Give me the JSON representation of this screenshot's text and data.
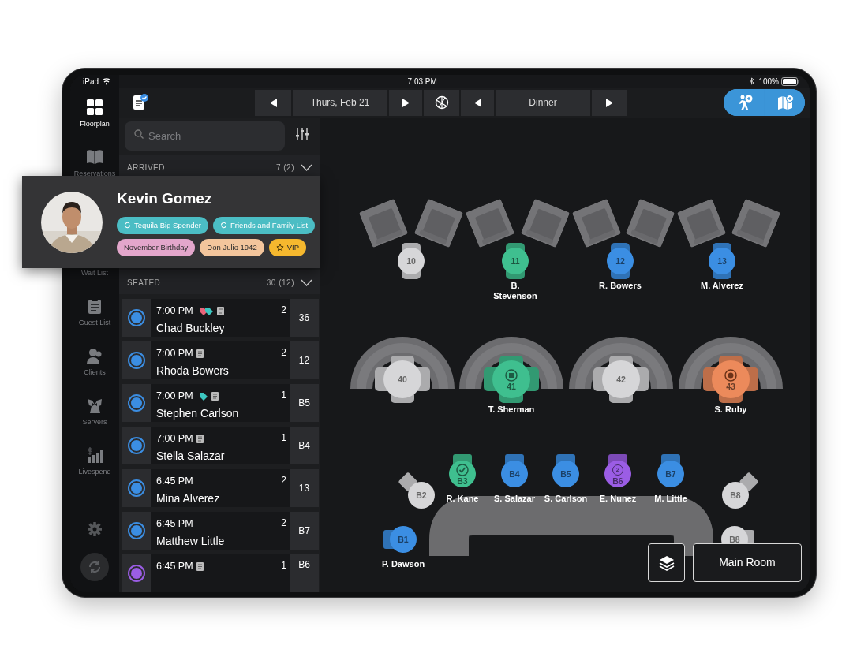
{
  "status_bar": {
    "device": "iPad",
    "time": "7:03 PM",
    "battery": "100%"
  },
  "sidebar": {
    "items": [
      {
        "label": "Floorplan",
        "selected": true
      },
      {
        "label": "Reservations",
        "selected": false
      },
      {
        "label": "Wait List",
        "selected": false
      },
      {
        "label": "Guest List",
        "selected": false
      },
      {
        "label": "Clients",
        "selected": false
      },
      {
        "label": "Servers",
        "selected": false
      },
      {
        "label": "Livespend",
        "selected": false
      }
    ]
  },
  "toolbar": {
    "date": "Thurs, Feb 21",
    "service": "Dinner"
  },
  "search": {
    "placeholder": "Search"
  },
  "sections": [
    {
      "title": "ARRIVED",
      "count": "7 (2)"
    },
    {
      "title": "SEATED",
      "count": "30 (12)"
    }
  ],
  "reservations": [
    {
      "time": "7:00 PM",
      "name": "Chad Buckley",
      "party": "2",
      "table": "36",
      "color": "#3b8ee3",
      "note": true,
      "tags": [
        {
          "color": "#e8657a"
        },
        {
          "color": "#3cc6c0"
        }
      ]
    },
    {
      "time": "7:00 PM",
      "name": "Rhoda Bowers",
      "party": "2",
      "table": "12",
      "color": "#3b8ee3",
      "note": true
    },
    {
      "time": "7:00 PM",
      "name": "Stephen Carlson",
      "party": "1",
      "table": "B5",
      "color": "#3b8ee3",
      "note": true,
      "tags": [
        {
          "color": "#3cc6c0"
        }
      ]
    },
    {
      "time": "7:00 PM",
      "name": "Stella Salazar",
      "party": "1",
      "table": "B4",
      "color": "#3b8ee3",
      "note": true
    },
    {
      "time": "6:45 PM",
      "name": "Mina Alverez",
      "party": "2",
      "table": "13",
      "color": "#3b8ee3",
      "note": false
    },
    {
      "time": "6:45 PM",
      "name": "Matthew Little",
      "party": "2",
      "table": "B7",
      "color": "#3b8ee3",
      "note": false
    },
    {
      "time": "6:45 PM",
      "party": "1",
      "table": "B6",
      "color": "#9b5de5",
      "note": true
    }
  ],
  "guest_card": {
    "name": "Kevin Gomez",
    "tags": [
      {
        "label": "Tequila Big Spender",
        "color": "#4bbdc4",
        "kind": "list"
      },
      {
        "label": "Friends and Family List",
        "color": "#4bbdc4",
        "kind": "list"
      },
      {
        "label": "November Birthday",
        "color": "#e3a6cb"
      },
      {
        "label": "Don Julio 1942",
        "color": "#f3c59c"
      },
      {
        "label": "VIP",
        "color": "#f5b82e",
        "kind": "vip"
      }
    ]
  },
  "floor": {
    "room": "Main Room",
    "tables": [
      {
        "number": "10",
        "color": "#d6d6d8"
      },
      {
        "number": "11",
        "color": "#3fbf8f",
        "guest": "B. Stevenson"
      },
      {
        "number": "12",
        "color": "#3b8ee3",
        "guest": "R. Bowers"
      },
      {
        "number": "13",
        "color": "#3b8ee3",
        "guest": "M. Alverez"
      },
      {
        "number": "40",
        "color": "#d6d6d8"
      },
      {
        "number": "41",
        "color": "#3fbf8f",
        "guest": "T. Sherman",
        "kind": "note"
      },
      {
        "number": "42",
        "color": "#d6d6d8"
      },
      {
        "number": "43",
        "color": "#ec8a5b",
        "guest": "S. Ruby",
        "kind": "target"
      },
      {
        "number": "B2",
        "color": "#d6d6d8"
      },
      {
        "number": "B3",
        "color": "#3fbf8f",
        "guest": "R. Kane",
        "kind": "check"
      },
      {
        "number": "B4",
        "color": "#3b8ee3",
        "guest": "S. Salazar"
      },
      {
        "number": "B5",
        "color": "#3b8ee3",
        "guest": "S. Carlson"
      },
      {
        "number": "B6",
        "color": "#9b5de5",
        "guest": "E. Nunez",
        "course": "2"
      },
      {
        "number": "B7",
        "color": "#3b8ee3",
        "guest": "M. Little"
      },
      {
        "number": "B8",
        "color": "#d6d6d8"
      },
      {
        "number": "B1",
        "color": "#3b8ee3",
        "guest": "P. Dawson"
      },
      {
        "number": "B8",
        "color": "#d6d6d8"
      }
    ]
  }
}
